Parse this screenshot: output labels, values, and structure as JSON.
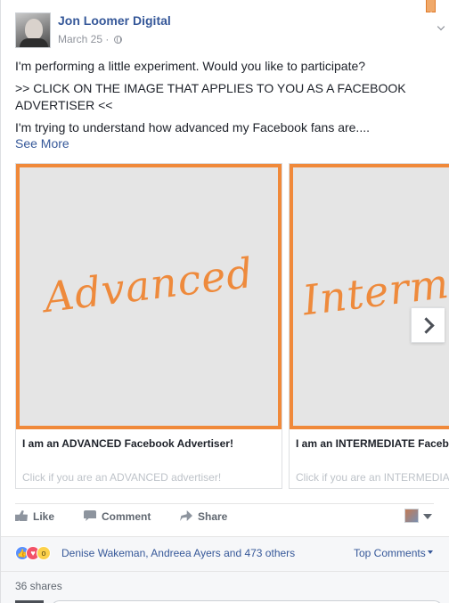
{
  "post": {
    "page_name": "Jon Loomer Digital",
    "date": "March 25",
    "date_separator": "·",
    "text_line1": "I'm performing a little experiment. Would you like to participate?",
    "text_line2": ">> CLICK ON THE IMAGE THAT APPLIES TO YOU AS A FACEBOOK ADVERTISER <<",
    "text_line3": "I'm trying to understand how advanced my Facebook fans are....",
    "see_more": "See More"
  },
  "carousel": {
    "cards": [
      {
        "image_text": "Advanced",
        "title": "I am an ADVANCED Facebook Advertiser!",
        "description": "Click if you are an ADVANCED advertiser!"
      },
      {
        "image_text": "Interme",
        "title": "I am an INTERMEDIATE Faceb",
        "description": "Click if you are an INTERMEDIA"
      }
    ]
  },
  "actions": {
    "like": "Like",
    "comment": "Comment",
    "share": "Share"
  },
  "reactions": {
    "names": "Denise Wakeman, Andreea Ayers and 473 others",
    "top_comments": "Top Comments",
    "shares": "36 shares"
  },
  "colors": {
    "accent": "#f0893a",
    "link": "#365899"
  }
}
